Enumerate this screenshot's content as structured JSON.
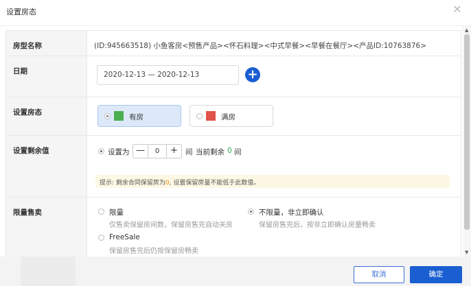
{
  "dialog": {
    "title": "设置房态",
    "close_icon": "close-icon"
  },
  "rows": {
    "room_type": {
      "label": "房型名称",
      "value": "(ID:945663518) 小鱼客房<预售产品><怀石料理><中式早餐><早餐在餐厅><产品ID:10763876>"
    },
    "date": {
      "label": "日期",
      "range": "2020-12-13 — 2020-12-13",
      "add_icon": "plus-circle-icon"
    },
    "room_status": {
      "label": "设置房态",
      "options": [
        {
          "label": "有房",
          "color": "#4caf50",
          "selected": true
        },
        {
          "label": "满房",
          "color": "#e0534a",
          "selected": false
        }
      ]
    },
    "remaining": {
      "label": "设置剩余值",
      "set_to": "设置为",
      "minus": "—",
      "value": "0",
      "plus": "+",
      "unit": "间",
      "current_prefix": "当前剩余",
      "current_value": "0",
      "current_unit": "间",
      "tip_prefix": "提示: 剩余合同保留房为",
      "tip_value": "0",
      "tip_suffix": ", 设置保留房量不能低于此数值。"
    },
    "limit_sale": {
      "label": "限量售卖",
      "options": [
        {
          "title": "限量",
          "desc": "仅售卖保留房间数，保留房售完自动关房",
          "selected": false
        },
        {
          "title": "不限量，非立即确认",
          "desc": "保留房售完后，按非立即确认房量畅卖",
          "selected": true
        },
        {
          "title": "FreeSale",
          "desc": "保留房售完后仍按保留房畅卖",
          "selected": false
        }
      ]
    }
  },
  "footer": {
    "cancel": "取消",
    "ok": "确定"
  },
  "colors": {
    "primary": "#1a5fd1",
    "highlight_bg": "#dde9f9",
    "tip_bg": "#fdf8e4",
    "green": "#2eab4f",
    "orange": "#f08a00"
  }
}
